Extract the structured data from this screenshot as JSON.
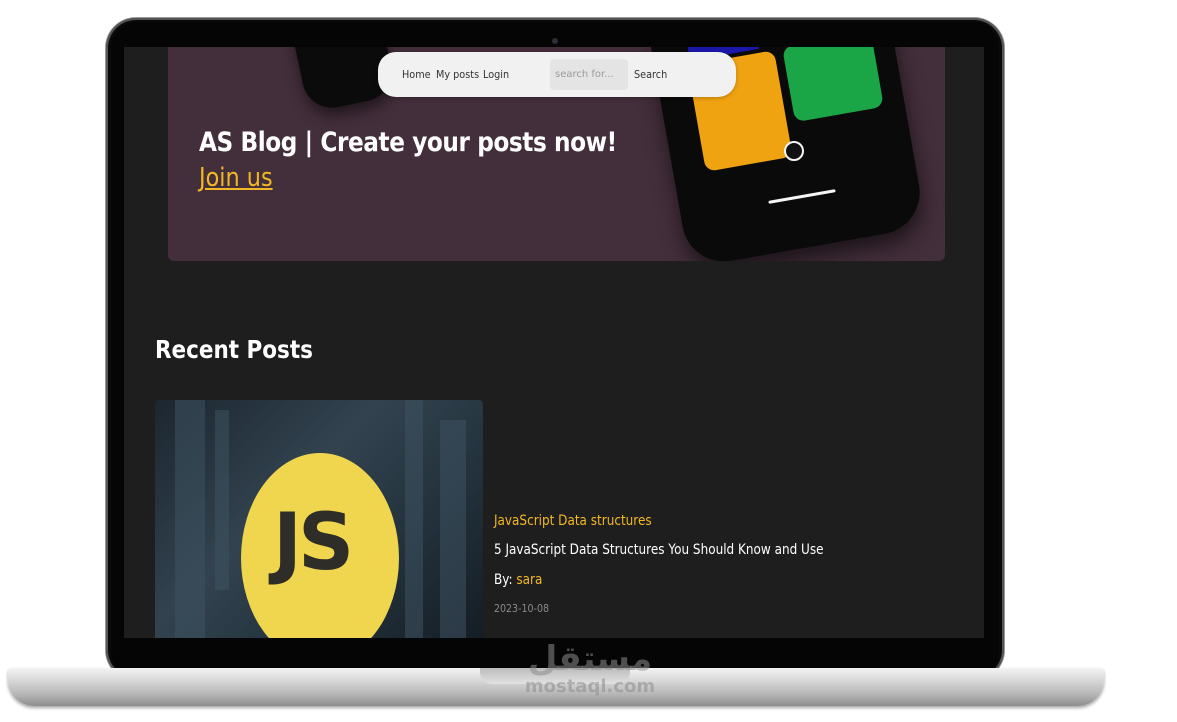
{
  "nav": {
    "home": "Home",
    "my_posts": "My posts",
    "login": "Login",
    "search_placeholder": "search for...",
    "search_button": "Search"
  },
  "hero": {
    "title": "AS Blog | Create your posts now!",
    "cta": "Join us"
  },
  "recent": {
    "heading": "Recent Posts",
    "posts": [
      {
        "image_text": "JS",
        "category": "JavaScript Data structures",
        "title": "5 JavaScript Data Structures You Should Know and Use",
        "author_prefix": "By:",
        "author": "sara",
        "date": "2023-10-08"
      }
    ]
  },
  "watermark": {
    "arabic": "مستقل",
    "latin": "mostaql.com"
  },
  "colors": {
    "accent": "#f2b824",
    "hero_bg": "#432e3b",
    "page_bg": "#1e1e1e"
  }
}
